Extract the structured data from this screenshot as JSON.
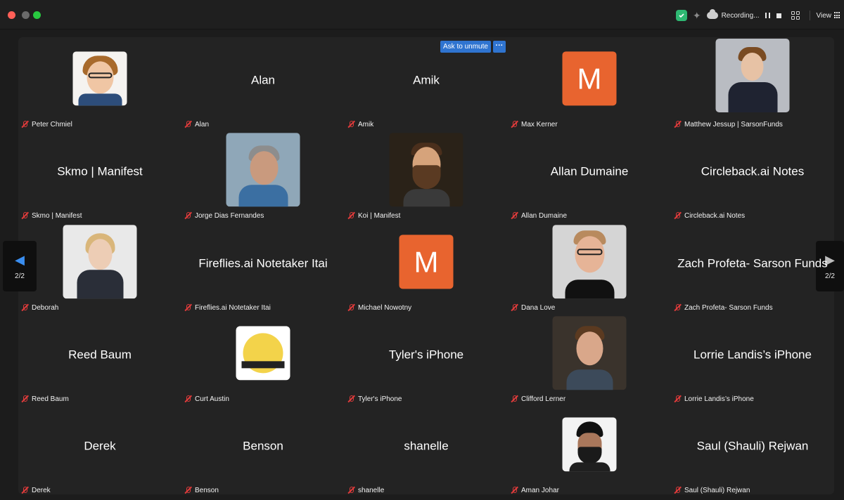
{
  "window": {
    "recording_label": "Recording...",
    "view_label": "View",
    "colors": {
      "close": "#ff5f57",
      "minimize": "#6a6a6a",
      "maximize": "#28c840",
      "accent": "#2f74d0",
      "muted_mic": "#e23b3b",
      "avatar_letter_bg": "#e8642f"
    }
  },
  "controls": {
    "ask_to_unmute": "Ask to unmute",
    "more": "···"
  },
  "pagination": {
    "left_page": "2/2",
    "right_page": "2/2",
    "left_arrow": "◀",
    "right_arrow": "▶"
  },
  "participants": [
    {
      "name": "Peter Chmiel",
      "display": "",
      "avatar": "photo"
    },
    {
      "name": "Alan",
      "display": "Alan",
      "avatar": "none"
    },
    {
      "name": "Amik",
      "display": "Amik",
      "avatar": "none"
    },
    {
      "name": "Max Kerner",
      "display": "",
      "avatar": "letter",
      "letter": "M"
    },
    {
      "name": "Matthew Jessup | SarsonFunds",
      "display": "",
      "avatar": "photo"
    },
    {
      "name": "Skmo | Manifest",
      "display": "Skmo | Manifest",
      "avatar": "none"
    },
    {
      "name": "Jorge Dias Fernandes",
      "display": "",
      "avatar": "photo"
    },
    {
      "name": "Koi | Manifest",
      "display": "",
      "avatar": "photo"
    },
    {
      "name": "Allan Dumaine",
      "display": "Allan Dumaine",
      "avatar": "none"
    },
    {
      "name": "Circleback.ai Notes",
      "display": "Circleback.ai Notes",
      "avatar": "none"
    },
    {
      "name": "Deborah",
      "display": "",
      "avatar": "photo"
    },
    {
      "name": "Fireflies.ai Notetaker Itai",
      "display": "Fireflies.ai Notetaker Itai",
      "avatar": "none"
    },
    {
      "name": "Michael Nowotny",
      "display": "",
      "avatar": "letter",
      "letter": "M"
    },
    {
      "name": "Dana Love",
      "display": "",
      "avatar": "photo"
    },
    {
      "name": "Zach Profeta- Sarson Funds",
      "display": "Zach Profeta- Sarson Funds",
      "avatar": "none"
    },
    {
      "name": "Reed Baum",
      "display": "Reed Baum",
      "avatar": "none"
    },
    {
      "name": "Curt Austin",
      "display": "",
      "avatar": "logo"
    },
    {
      "name": "Tyler's iPhone",
      "display": "Tyler's iPhone",
      "avatar": "none"
    },
    {
      "name": "Clifford Lerner",
      "display": "",
      "avatar": "photo"
    },
    {
      "name": "Lorrie Landis’s iPhone",
      "display": "Lorrie Landis’s iPhone",
      "avatar": "none"
    },
    {
      "name": "Derek",
      "display": "Derek",
      "avatar": "none"
    },
    {
      "name": "Benson",
      "display": "Benson",
      "avatar": "none"
    },
    {
      "name": "shanelle",
      "display": "shanelle",
      "avatar": "none"
    },
    {
      "name": "Aman Johar",
      "display": "",
      "avatar": "photo"
    },
    {
      "name": "Saul (Shauli) Rejwan",
      "display": "Saul (Shauli) Rejwan",
      "avatar": "none"
    }
  ]
}
